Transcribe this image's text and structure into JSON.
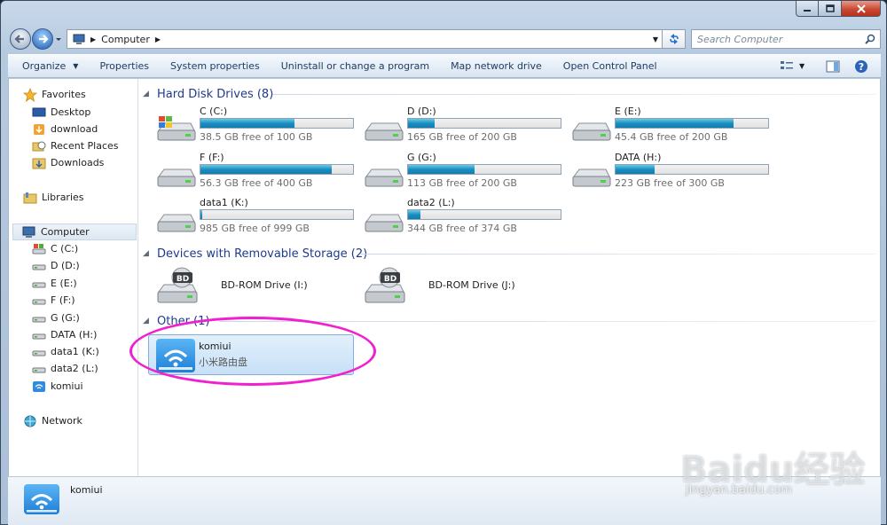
{
  "window": {
    "caption_buttons": [
      "minimize-icon",
      "maximize-icon",
      "close-icon"
    ]
  },
  "address": {
    "path_root_icon": "computer-icon",
    "path": "Computer",
    "search_placeholder": "Search Computer"
  },
  "toolbar": {
    "organize": "Organize",
    "properties": "Properties",
    "system_properties": "System properties",
    "uninstall": "Uninstall or change a program",
    "map_network": "Map network drive",
    "control_panel": "Open Control Panel"
  },
  "nav": {
    "favorites": "Favorites",
    "desktop": "Desktop",
    "download": "download",
    "recent_places": "Recent Places",
    "downloads": "Downloads",
    "libraries": "Libraries",
    "computer": "Computer",
    "drives": [
      "C (C:)",
      "D (D:)",
      "E (E:)",
      "F (F:)",
      "G (G:)",
      "DATA (H:)",
      "data1 (K:)",
      "data2 (L:)",
      "komiui"
    ],
    "network": "Network"
  },
  "groups": {
    "hdd": "Hard Disk Drives (8)",
    "removable": "Devices with Removable Storage (2)",
    "other": "Other (1)"
  },
  "hard_drives": [
    {
      "name": "C (C:)",
      "free": "38.5 GB free of 100 GB",
      "used_fraction": 0.615
    },
    {
      "name": "D (D:)",
      "free": "165 GB free of 200 GB",
      "used_fraction": 0.175
    },
    {
      "name": "E (E:)",
      "free": "45.4 GB free of 200 GB",
      "used_fraction": 0.773
    },
    {
      "name": "F (F:)",
      "free": "56.3 GB free of 400 GB",
      "used_fraction": 0.859
    },
    {
      "name": "G (G:)",
      "free": "113 GB free of 200 GB",
      "used_fraction": 0.435
    },
    {
      "name": "DATA (H:)",
      "free": "223 GB free of 300 GB",
      "used_fraction": 0.257
    },
    {
      "name": "data1 (K:)",
      "free": "985 GB free of 999 GB",
      "used_fraction": 0.014
    },
    {
      "name": "data2 (L:)",
      "free": "344 GB free of 374 GB",
      "used_fraction": 0.08
    }
  ],
  "removable": [
    {
      "name": "BD-ROM Drive (I:)",
      "badge": "BD"
    },
    {
      "name": "BD-ROM Drive (J:)",
      "badge": "BD"
    }
  ],
  "other": {
    "name": "komiui",
    "subtitle": "小米路由盘"
  },
  "details": {
    "name": "komiui"
  },
  "watermark": {
    "logo": "Baidu经验",
    "url": "jingyan.baidu.com"
  },
  "colors": {
    "group_header": "#1e3b8a",
    "drive_fill": "#1b8fc1",
    "highlight": "#f11fcf"
  }
}
